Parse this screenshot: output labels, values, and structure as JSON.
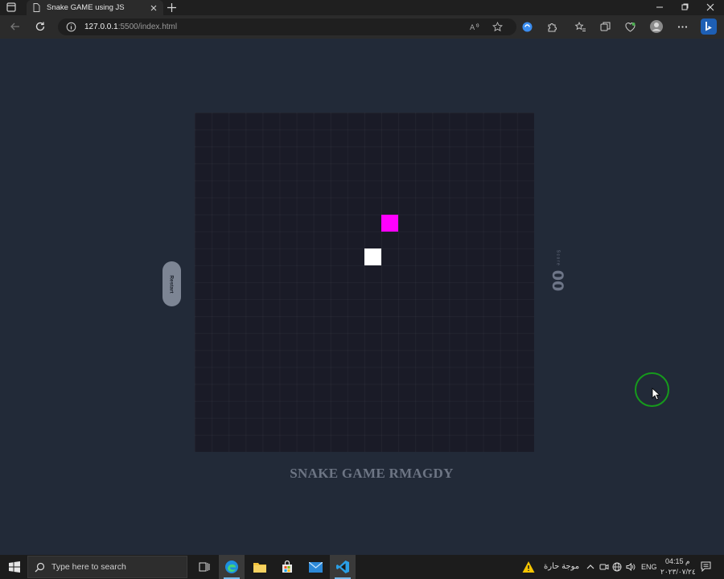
{
  "browser": {
    "tab_title": "Snake GAME using JS",
    "url_host": "127.0.0.1",
    "url_path": ":5500/index.html"
  },
  "game": {
    "restart_label": "Restart",
    "score_label": "Score",
    "score_value": "00",
    "title": "SNAKE GAME RMAGDY",
    "colors": {
      "board": "#1a1b27",
      "food": "#ff00ff",
      "snake": "#ffffff",
      "page": "#222a38"
    }
  },
  "taskbar": {
    "search_placeholder": "Type here to search",
    "weather_text": "موجة حارة",
    "language": "ENG",
    "time": "04:15 م",
    "date": "٢٠٢٣/٠٧/٢٤"
  }
}
